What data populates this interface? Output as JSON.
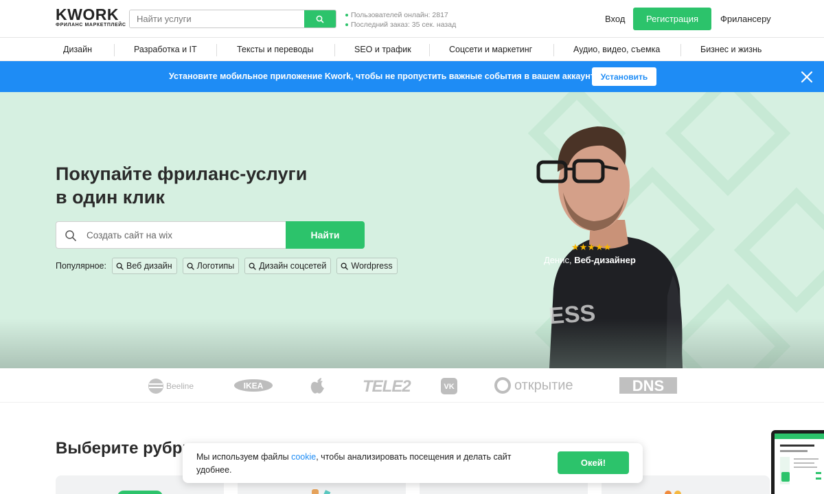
{
  "header": {
    "logo_text": "KWORK",
    "logo_subtitle": "ФРИЛАНС МАРКЕТПЛЕЙС",
    "search_placeholder": "Найти услуги",
    "stats_online": "Пользователей онлайн: 2817",
    "stats_last_order": "Последний заказ: 35 сек. назад",
    "login": "Вход",
    "register": "Регистрация",
    "for_freelancer": "Фрилансеру"
  },
  "categories": [
    "Дизайн",
    "Разработка и IT",
    "Тексты и переводы",
    "SEO и трафик",
    "Соцсети и маркетинг",
    "Аудио, видео, съемка",
    "Бизнес и жизнь"
  ],
  "app_banner": {
    "text": "Установите мобильное приложение Kwork, чтобы не пропустить важные события в вашем аккаунте!",
    "button": "Установить"
  },
  "hero": {
    "title_line1": "Покупайте фриланс-услуги",
    "title_line2": "в один клик",
    "search_placeholder": "Создать сайт на wix",
    "search_button": "Найти",
    "popular_label": "Популярное:",
    "popular_tags": [
      "Веб дизайн",
      "Логотипы",
      "Дизайн соцсетей",
      "Wordpress"
    ],
    "rating_stars": "★★★★★",
    "person_name": "Денис,",
    "person_role": "Веб-дизайнер"
  },
  "brands": [
    "Beeline",
    "IKEA",
    "Apple",
    "TELE2",
    "VK",
    "открытие",
    "DNS"
  ],
  "rubric": {
    "title": "Выберите рубри"
  },
  "cookie": {
    "text_before": "Мы используем файлы",
    "link": "cookie",
    "text_after": ", чтобы анализировать посещения и делать сайт удобнее.",
    "button": "Окей!"
  },
  "colors": {
    "green": "#2cc36b",
    "blue": "#1e8cf5",
    "hero_bg": "#d6f0e1"
  }
}
